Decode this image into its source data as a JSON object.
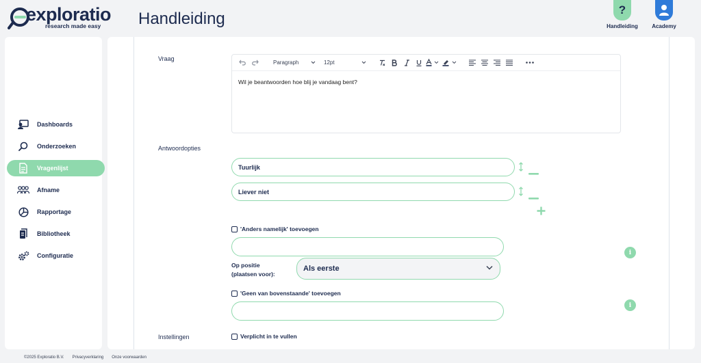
{
  "brand": {
    "name": "exploratio",
    "tagline": "research made easy",
    "accent": "#8fd9ad",
    "primary": "#1d2b4f",
    "academy_color": "#2f7bd9"
  },
  "header": {
    "title": "Handleiding",
    "help_label": "Handleiding",
    "help_icon": "?",
    "academy_label": "Academy"
  },
  "sidebar": {
    "items": [
      {
        "label": "Dashboards",
        "icon": "dashboard-icon",
        "active": false
      },
      {
        "label": "Onderzoeken",
        "icon": "search-icon",
        "active": false
      },
      {
        "label": "Vragenlijst",
        "icon": "document-icon",
        "active": true
      },
      {
        "label": "Afname",
        "icon": "users-icon",
        "active": false
      },
      {
        "label": "Rapportage",
        "icon": "pie-chart-icon",
        "active": false
      },
      {
        "label": "Bibliotheek",
        "icon": "library-icon",
        "active": false
      },
      {
        "label": "Configuratie",
        "icon": "gears-icon",
        "active": false
      }
    ]
  },
  "form": {
    "question_label": "Vraag",
    "editor": {
      "block_format": "Paragraph",
      "font_size": "12pt",
      "content": "Wil je beantwoorden hoe blij je vandaag bent?"
    },
    "answers_label": "Antwoordopties",
    "answers": [
      {
        "value": "Tuurlijk"
      },
      {
        "value": "Liever niet"
      }
    ],
    "other_checkbox": "'Anders namelijk' toevoegen",
    "other_input_value": "",
    "position_label_line1": "Op positie",
    "position_label_line2": "(plaatsen voor):",
    "position_value": "Als eerste",
    "none_checkbox": "'Geen van bovenstaande' toevoegen",
    "none_input_value": "",
    "info_icon": "i",
    "settings_label": "Instellingen",
    "required_checkbox": "Verplicht in te vullen"
  },
  "footer": {
    "copyright": "©2025 Exploratio B.V.",
    "privacy": "Privacyverklaring",
    "terms": "Onze voorwaarden"
  }
}
